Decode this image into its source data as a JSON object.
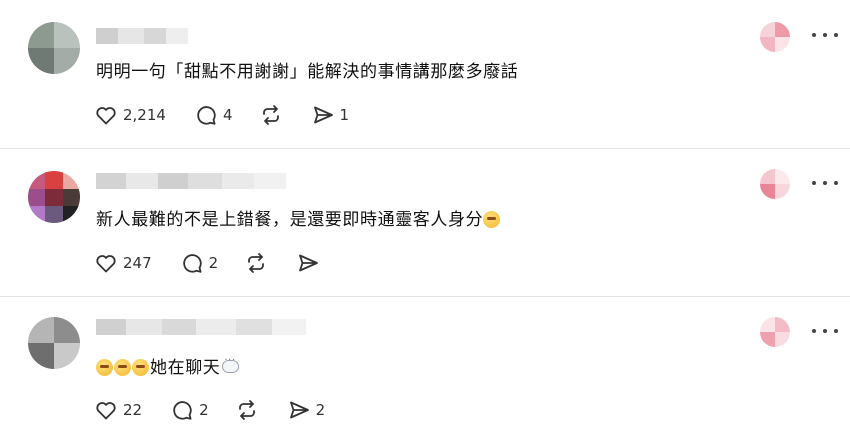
{
  "comments": [
    {
      "text": "明明一句「甜點不用謝謝」能解決的事情講那麼多廢話",
      "likes": "2,214",
      "replies": "4",
      "shares": "1"
    },
    {
      "text": "新人最難的不是上錯餐，是還要即時通靈客人身分",
      "likes": "247",
      "replies": "2",
      "shares": ""
    },
    {
      "text": "她在聊天",
      "likes": "22",
      "replies": "2",
      "shares": "2"
    }
  ],
  "icons": {
    "like": "heart-icon",
    "reply": "comment-icon",
    "repost": "repost-icon",
    "share": "send-icon",
    "more": "more-options-icon"
  },
  "colors": {
    "icon": "#333333",
    "divider": "#e3e3e3"
  }
}
